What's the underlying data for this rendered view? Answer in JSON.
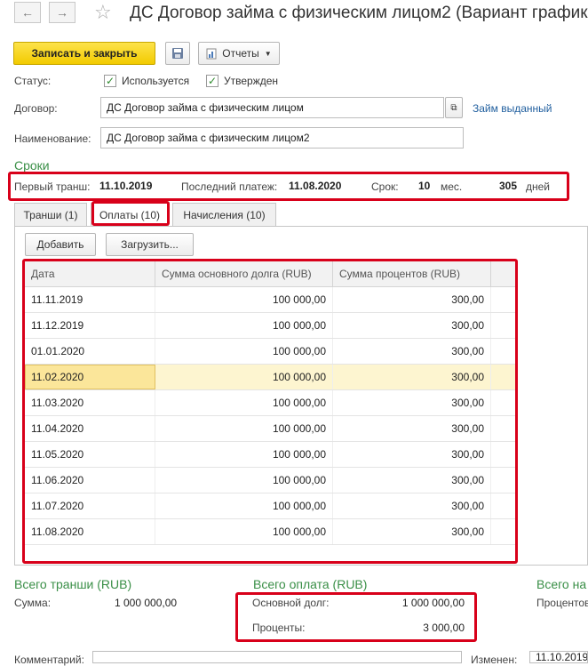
{
  "window": {
    "title": "ДС Договор займа с физическим лицом2 (Вариант графика"
  },
  "toolbar": {
    "save_close": "Записать и закрыть",
    "reports": "Отчеты"
  },
  "status": {
    "label": "Статус:",
    "in_use": "Используется",
    "approved": "Утвержден"
  },
  "contract": {
    "label": "Договор:",
    "value": "ДС Договор займа с физическим лицом",
    "link": "Займ выданный"
  },
  "name": {
    "label": "Наименование:",
    "value": "ДС Договор займа с физическим лицом2"
  },
  "terms": {
    "heading": "Сроки",
    "first_tranche_label": "Первый транш:",
    "first_tranche": "11.10.2019",
    "last_payment_label": "Последний платеж:",
    "last_payment": "11.08.2020",
    "term_label": "Срок:",
    "months": "10",
    "months_unit": "мес.",
    "days": "305",
    "days_unit": "дней"
  },
  "tabs": [
    {
      "label": "Транши (1)"
    },
    {
      "label": "Оплаты (10)"
    },
    {
      "label": "Начисления (10)"
    }
  ],
  "panel": {
    "add": "Добавить",
    "load": "Загрузить..."
  },
  "table": {
    "columns": [
      "Дата",
      "Сумма основного долга (RUB)",
      "Сумма процентов (RUB)"
    ],
    "rows": [
      [
        "11.11.2019",
        "100 000,00",
        "300,00"
      ],
      [
        "11.12.2019",
        "100 000,00",
        "300,00"
      ],
      [
        "01.01.2020",
        "100 000,00",
        "300,00"
      ],
      [
        "11.02.2020",
        "100 000,00",
        "300,00"
      ],
      [
        "11.03.2020",
        "100 000,00",
        "300,00"
      ],
      [
        "11.04.2020",
        "100 000,00",
        "300,00"
      ],
      [
        "11.05.2020",
        "100 000,00",
        "300,00"
      ],
      [
        "11.06.2020",
        "100 000,00",
        "300,00"
      ],
      [
        "11.07.2020",
        "100 000,00",
        "300,00"
      ],
      [
        "11.08.2020",
        "100 000,00",
        "300,00"
      ]
    ]
  },
  "totals": {
    "tranches_heading": "Всего транши (RUB)",
    "sum_label": "Сумма:",
    "sum_value": "1 000 000,00",
    "payments_heading": "Всего оплата (RUB)",
    "principal_label": "Основной долг:",
    "principal_value": "1 000 000,00",
    "interest_label": "Проценты:",
    "interest_value": "3 000,00",
    "third_heading": "Всего на",
    "third_label": "Процентов"
  },
  "footer": {
    "comment_label": "Комментарий:",
    "changed_label": "Изменен:",
    "changed_value": "11.10.2019"
  }
}
